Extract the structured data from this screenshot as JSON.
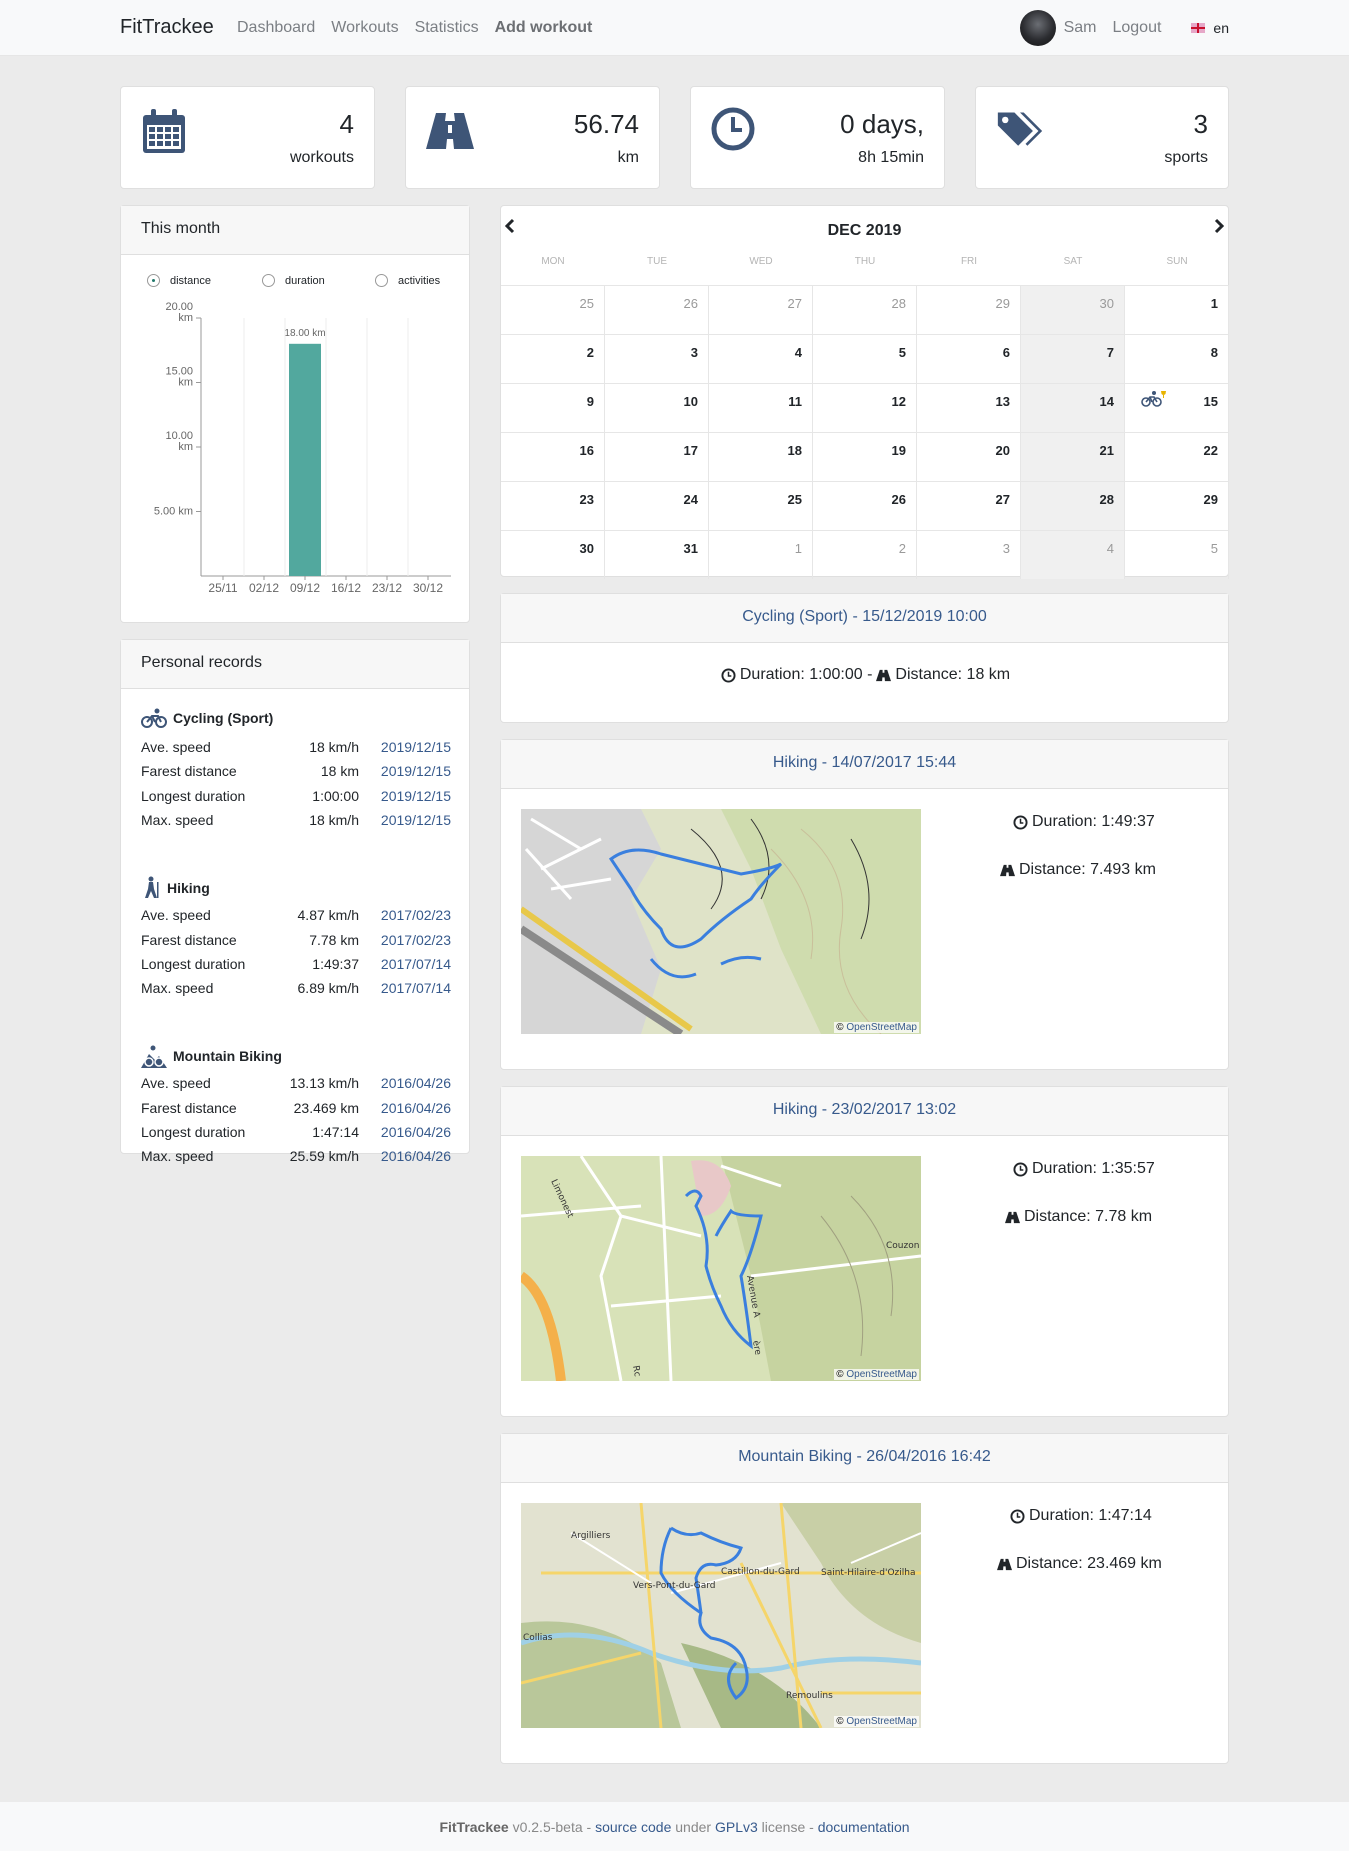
{
  "nav": {
    "brand": "FitTrackee",
    "links": [
      "Dashboard",
      "Workouts",
      "Statistics",
      "Add workout"
    ],
    "user": "Sam",
    "logout": "Logout",
    "lang": "en"
  },
  "stats": [
    {
      "value": "4",
      "label": "workouts",
      "icon": "calendar-icon"
    },
    {
      "value": "56.74",
      "label": "km",
      "icon": "road-icon"
    },
    {
      "value": "0 days,",
      "label": "8h 15min",
      "icon": "clock-icon"
    },
    {
      "value": "3",
      "label": "sports",
      "icon": "tags-icon"
    }
  ],
  "month": {
    "title": "This month",
    "options": [
      "distance",
      "duration",
      "activities"
    ],
    "selected": "distance"
  },
  "chart_data": {
    "type": "bar",
    "categories": [
      "25/11",
      "02/12",
      "09/12",
      "16/12",
      "23/12",
      "30/12"
    ],
    "values": [
      0,
      0,
      18,
      0,
      0,
      0
    ],
    "data_labels": [
      "",
      "",
      "18.00 km",
      "",
      "",
      ""
    ],
    "y_ticks": [
      {
        "v": 5,
        "label": [
          "5.00 km"
        ]
      },
      {
        "v": 10,
        "label": [
          "10.00",
          "km"
        ]
      },
      {
        "v": 15,
        "label": [
          "15.00",
          "km"
        ]
      },
      {
        "v": 20,
        "label": [
          "20.00",
          "km"
        ]
      }
    ],
    "ylim": [
      0,
      20
    ],
    "color": "#52a89e",
    "grid": false
  },
  "records": {
    "title": "Personal records",
    "sports": [
      {
        "name": "Cycling (Sport)",
        "icon": "cycling-icon",
        "rows": [
          {
            "label": "Ave. speed",
            "value": "18 km/h",
            "date": "2019/12/15"
          },
          {
            "label": "Farest distance",
            "value": "18 km",
            "date": "2019/12/15"
          },
          {
            "label": "Longest duration",
            "value": "1:00:00",
            "date": "2019/12/15"
          },
          {
            "label": "Max. speed",
            "value": "18 km/h",
            "date": "2019/12/15"
          }
        ]
      },
      {
        "name": "Hiking",
        "icon": "hiking-icon",
        "rows": [
          {
            "label": "Ave. speed",
            "value": "4.87 km/h",
            "date": "2017/02/23"
          },
          {
            "label": "Farest distance",
            "value": "7.78 km",
            "date": "2017/02/23"
          },
          {
            "label": "Longest duration",
            "value": "1:49:37",
            "date": "2017/07/14"
          },
          {
            "label": "Max. speed",
            "value": "6.89 km/h",
            "date": "2017/07/14"
          }
        ]
      },
      {
        "name": "Mountain Biking",
        "icon": "mountain-biking-icon",
        "rows": [
          {
            "label": "Ave. speed",
            "value": "13.13 km/h",
            "date": "2016/04/26"
          },
          {
            "label": "Farest distance",
            "value": "23.469 km",
            "date": "2016/04/26"
          },
          {
            "label": "Longest duration",
            "value": "1:47:14",
            "date": "2016/04/26"
          },
          {
            "label": "Max. speed",
            "value": "25.59 km/h",
            "date": "2016/04/26"
          }
        ]
      }
    ]
  },
  "calendar": {
    "title": "DEC 2019",
    "days": [
      "MON",
      "TUE",
      "WED",
      "THU",
      "FRI",
      "SAT",
      "SUN"
    ],
    "weeks": [
      [
        [
          "25",
          1
        ],
        [
          "26",
          1
        ],
        [
          "27",
          1
        ],
        [
          "28",
          1
        ],
        [
          "29",
          1
        ],
        [
          "30",
          1
        ],
        [
          "1",
          0
        ]
      ],
      [
        [
          "2",
          0
        ],
        [
          "3",
          0
        ],
        [
          "4",
          0
        ],
        [
          "5",
          0
        ],
        [
          "6",
          0
        ],
        [
          "7",
          0
        ],
        [
          "8",
          0
        ]
      ],
      [
        [
          "9",
          0
        ],
        [
          "10",
          0
        ],
        [
          "11",
          0
        ],
        [
          "12",
          0
        ],
        [
          "13",
          0
        ],
        [
          "14",
          0
        ],
        [
          "15",
          0
        ]
      ],
      [
        [
          "16",
          0
        ],
        [
          "17",
          0
        ],
        [
          "18",
          0
        ],
        [
          "19",
          0
        ],
        [
          "20",
          0
        ],
        [
          "21",
          0
        ],
        [
          "22",
          0
        ]
      ],
      [
        [
          "23",
          0
        ],
        [
          "24",
          0
        ],
        [
          "25",
          0
        ],
        [
          "26",
          0
        ],
        [
          "27",
          0
        ],
        [
          "28",
          0
        ],
        [
          "29",
          0
        ]
      ],
      [
        [
          "30",
          0
        ],
        [
          "31",
          0
        ],
        [
          "1",
          1
        ],
        [
          "2",
          1
        ],
        [
          "3",
          1
        ],
        [
          "4",
          1
        ],
        [
          "5",
          1
        ]
      ]
    ]
  },
  "workouts": [
    {
      "title": "Cycling (Sport) - 15/12/2019 10:00",
      "duration": "Duration: 1:00:00 -",
      "distance": "Distance: 18 km",
      "map": false
    },
    {
      "title": "Hiking - 14/07/2017 15:44",
      "duration": "Duration: 1:49:37",
      "distance": "Distance: 7.493 km",
      "map": true
    },
    {
      "title": "Hiking - 23/02/2017 13:02",
      "duration": "Duration: 1:35:57",
      "distance": "Distance: 7.78 km",
      "map": true
    },
    {
      "title": "Mountain Biking - 26/04/2016 16:42",
      "duration": "Duration: 1:47:14",
      "distance": "Distance: 23.469 km",
      "map": true
    }
  ],
  "maps": {
    "attribution_prefix": "©",
    "attribution": "OpenStreetMap",
    "labels_hike2": [
      "Limonest",
      "Avenue A",
      "ère",
      "Couzon",
      "Rc"
    ],
    "labels_mtb": [
      "Argilliers",
      "Castillon-du-Gard",
      "Saint-Hilaire-d'Ozilha",
      "Vers-Pont-du-Gard",
      "Collias",
      "Remoulins"
    ]
  },
  "footer": {
    "brand": "FitTrackee",
    "version": "v0.2.5-beta -",
    "source": "source code",
    "under": "under",
    "license": "GPLv3",
    "license_suffix": "license -",
    "docs": "documentation"
  }
}
